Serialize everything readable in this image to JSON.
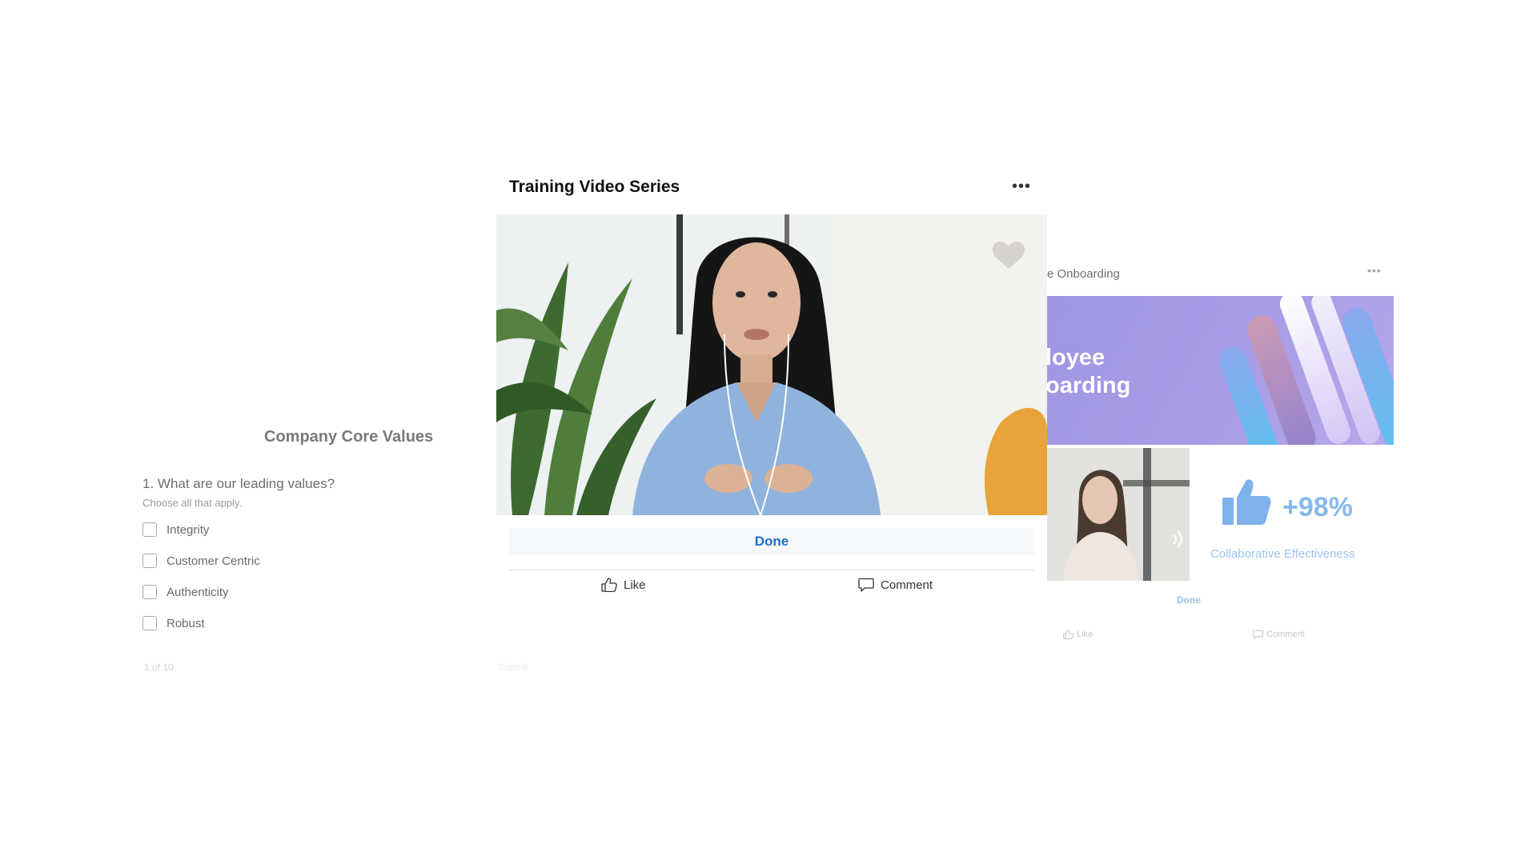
{
  "quiz": {
    "title": "Company Core Values",
    "question": "1. What are our leading values?",
    "hint": "Choose all that apply.",
    "options": [
      "Integrity",
      "Customer Centric",
      "Authenticity",
      "Robust"
    ],
    "pager": "1 of 10",
    "submit_label": "Submit"
  },
  "post": {
    "title": "Training Video Series",
    "more_icon": "more-horizontal-icon",
    "done_label": "Done",
    "like_label": "Like",
    "comment_label": "Comment"
  },
  "onboarding": {
    "title": "e Onboarding",
    "banner_text": "loyee\noarding",
    "stat_value": "+98%",
    "stat_label": "Collaborative Effectiveness",
    "done_label": "Done",
    "like_label": "Like",
    "comment_label": "Comment"
  },
  "colors": {
    "accent": "#1a6fc9",
    "banner": "#a89ce6",
    "stat": "#86b8ec"
  }
}
